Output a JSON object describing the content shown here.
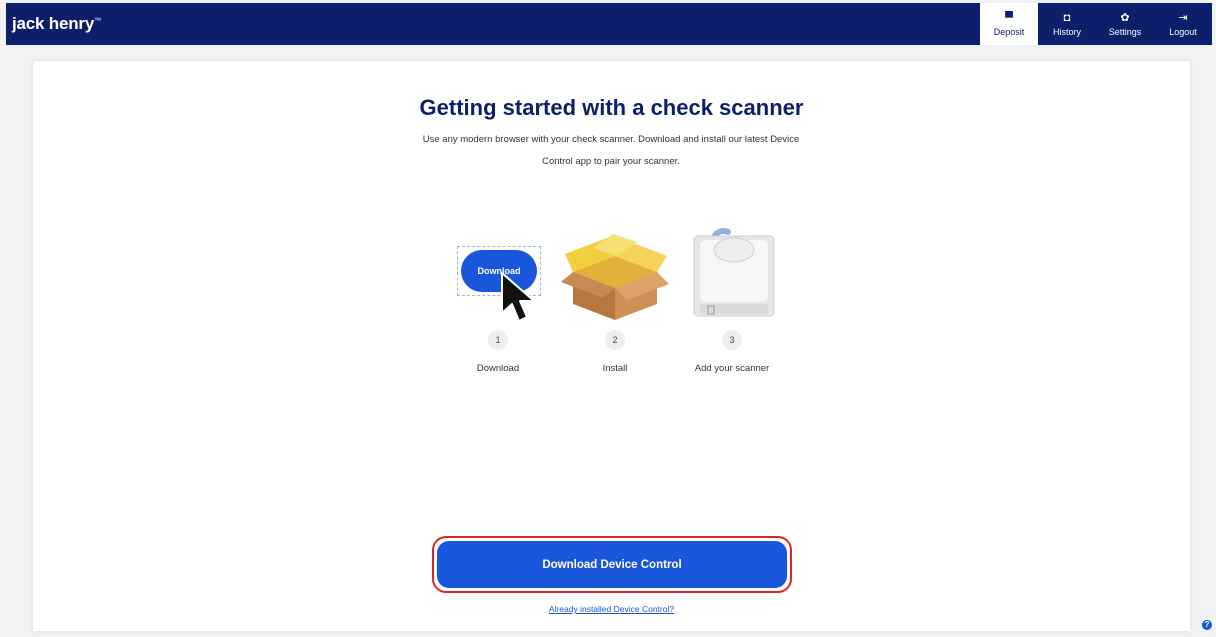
{
  "header": {
    "brand": "jack henry",
    "brand_mark": "™",
    "nav": [
      {
        "label": "Deposit",
        "icon": "scanner-icon",
        "active": true
      },
      {
        "label": "History",
        "icon": "history-icon"
      },
      {
        "label": "Settings",
        "icon": "gear-icon"
      },
      {
        "label": "Logout",
        "icon": "logout-icon"
      }
    ]
  },
  "main": {
    "title": "Getting started with a check scanner",
    "subtitle_line1": "Use any modern browser with your check scanner. Download and install our latest Device",
    "subtitle_line2": "Control app to pair your scanner.",
    "steps": [
      {
        "number": "1",
        "label": "Download",
        "illustration_button_label": "Download"
      },
      {
        "number": "2",
        "label": "Install"
      },
      {
        "number": "3",
        "label": "Add your scanner"
      }
    ],
    "cta_label": "Download Device Control",
    "already_installed_link": "Already installed Device Control?"
  },
  "help_icon": "?",
  "colors": {
    "navy": "#0b1f6b",
    "primary_blue": "#1a56db",
    "highlight_red": "#d9262c",
    "box_tan": "#c98a52",
    "box_yellow": "#f1cf3d"
  }
}
